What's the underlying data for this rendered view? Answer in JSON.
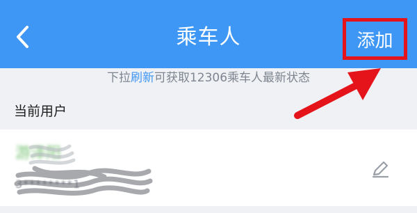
{
  "header": {
    "back_icon": "chevron-left-icon",
    "title": "乘车人",
    "add_label": "添加"
  },
  "hint": {
    "prefix": "下拉",
    "link": "刷新",
    "suffix": "可获取12306乘车人最新状态"
  },
  "section": {
    "title": "当前用户"
  },
  "passenger": {
    "name": "游泽阳",
    "id_masked": "3********1"
  },
  "colors": {
    "header_bg": "#3f97f5",
    "highlight": "#e5141b",
    "link": "#3f97f5",
    "page_bg": "#f0f1f4"
  },
  "icons": {
    "edit": "pencil-icon"
  }
}
